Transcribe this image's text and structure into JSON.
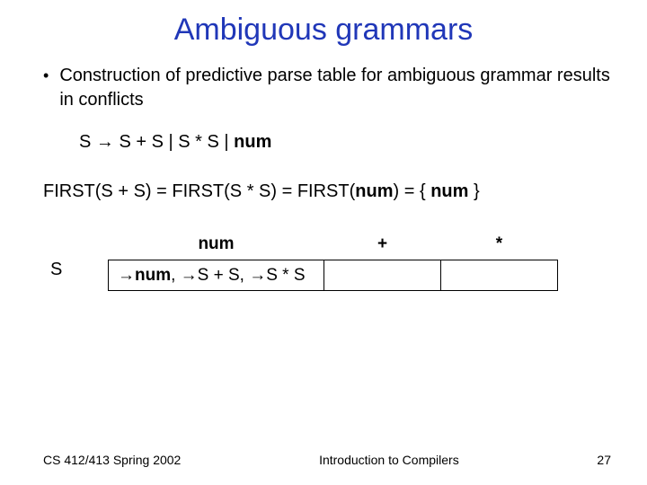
{
  "title": "Ambiguous grammars",
  "bullet": "Construction of predictive parse table for ambiguous grammar results in conflicts",
  "grammar": {
    "lhs": "S",
    "arrow": "→",
    "rhs1": "S + S | S * S |",
    "rhs_last": "num"
  },
  "first_line": {
    "p1": "FIRST(S + S) = FIRST(S * S) = FIRST(",
    "num1": "num",
    "p2": ") = {",
    "num2": "num",
    "p3": "}"
  },
  "table": {
    "row_label": "S",
    "headers": {
      "c1": "num",
      "c2": "+",
      "c3": "*"
    },
    "cell": {
      "arrow": "→",
      "seg1_bold": "num",
      "seg1_tail": ",",
      "seg2": "S + S,",
      "seg3": "S * S"
    }
  },
  "footer": {
    "left": "CS 412/413  Spring 2002",
    "center": "Introduction to Compilers",
    "right": "27"
  }
}
